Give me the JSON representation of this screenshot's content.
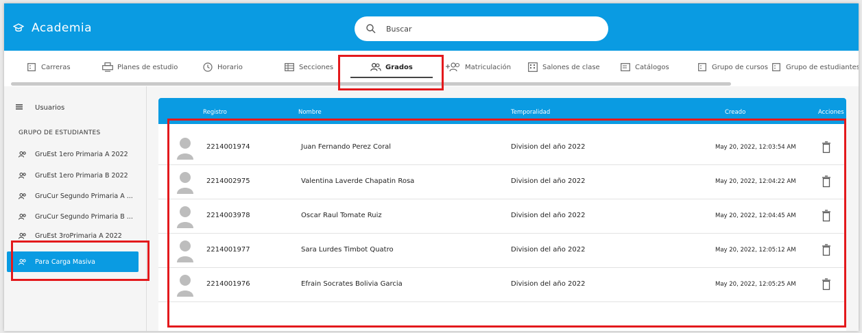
{
  "app": {
    "title": "Academia"
  },
  "search": {
    "placeholder": "Buscar",
    "value": ""
  },
  "tabs": [
    {
      "label": "Carreras",
      "icon": "list-box-icon"
    },
    {
      "label": "Planes de estudio",
      "icon": "printer-icon"
    },
    {
      "label": "Horario",
      "icon": "clock-icon"
    },
    {
      "label": "Secciones",
      "icon": "table-icon"
    },
    {
      "label": "Grados",
      "icon": "users-icon",
      "active": true
    },
    {
      "label": "Matriculación",
      "icon": "add-users-icon"
    },
    {
      "label": "Salones de clase",
      "icon": "building-icon"
    },
    {
      "label": "Catálogos",
      "icon": "catalog-icon"
    },
    {
      "label": "Grupo de cursos",
      "icon": "list-box-icon"
    },
    {
      "label": "Grupo de estudiantes",
      "icon": "list-box-icon"
    }
  ],
  "sidebar": {
    "top_item": "Usuarios",
    "group_title": "GRUPO DE ESTUDIANTES",
    "items": [
      {
        "label": "GruEst 1ero Primaria A 2022"
      },
      {
        "label": "GruEst 1ero Primaria B 2022"
      },
      {
        "label": "GruCur Segundo Primaria A ..."
      },
      {
        "label": "GruCur Segundo Primaria B ..."
      },
      {
        "label": "GruEst 3roPrimaria A 2022"
      },
      {
        "label": "Para Carga Masiva",
        "active": true
      }
    ]
  },
  "table": {
    "headers": {
      "registro": "Registro",
      "nombre": "Nombre",
      "temporalidad": "Temporalidad",
      "creado": "Creado",
      "acciones": "Acciones"
    },
    "rows": [
      {
        "registro": "2214001974",
        "nombre": "Juan Fernando Perez Coral",
        "temporalidad": "Division del año 2022",
        "creado": "May 20, 2022, 12:03:54 AM"
      },
      {
        "registro": "2214002975",
        "nombre": "Valentina Laverde Chapatin Rosa",
        "temporalidad": "Division del año 2022",
        "creado": "May 20, 2022, 12:04:22 AM"
      },
      {
        "registro": "2214003978",
        "nombre": "Oscar Raul Tomate Ruiz",
        "temporalidad": "Division del año 2022",
        "creado": "May 20, 2022, 12:04:45 AM"
      },
      {
        "registro": "2214001977",
        "nombre": "Sara Lurdes Timbot Quatro",
        "temporalidad": "Division del año 2022",
        "creado": "May 20, 2022, 12:05:12 AM"
      },
      {
        "registro": "2214001976",
        "nombre": "Efrain Socrates Bolivia Garcia",
        "temporalidad": "Division del año 2022",
        "creado": "May 20, 2022, 12:05:25 AM"
      }
    ]
  },
  "colors": {
    "primary": "#0a9be2",
    "highlight": "#e3191c"
  }
}
